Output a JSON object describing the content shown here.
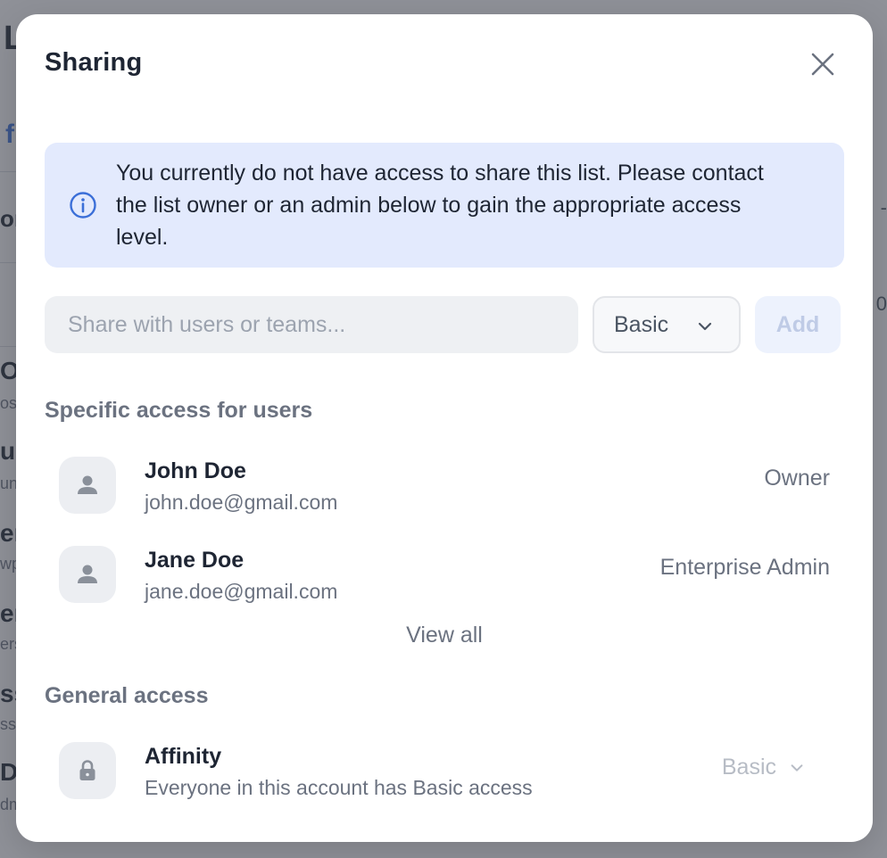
{
  "background": {
    "fragments": [
      "L",
      "f",
      "on",
      "O",
      "os",
      "ur",
      "un",
      "er",
      "wp",
      "er",
      "ers",
      "ss",
      "ss",
      "D",
      "dm"
    ],
    "right_fragments": [
      "-",
      "0"
    ]
  },
  "modal": {
    "title": "Sharing",
    "close_icon": "close-icon"
  },
  "notice": {
    "icon": "info-icon",
    "text": "You currently do not have access to share this list. Please contact the list owner or an admin below to gain the appropriate access level."
  },
  "share": {
    "placeholder": "Share with users or teams...",
    "value": "",
    "access_level": "Basic",
    "add_label": "Add"
  },
  "specific_access": {
    "heading": "Specific access for users",
    "users": [
      {
        "name": "John Doe",
        "email": "john.doe@gmail.com",
        "role": "Owner"
      },
      {
        "name": "Jane Doe",
        "email": "jane.doe@gmail.com",
        "role": "Enterprise Admin"
      }
    ],
    "view_all_label": "View all"
  },
  "general_access": {
    "heading": "General access",
    "name": "Affinity",
    "description": "Everyone in this account has Basic access",
    "level": "Basic"
  },
  "colors": {
    "accent_blue": "#3b6fd8",
    "banner_bg": "#e3eafd",
    "text_primary": "#1e2533",
    "text_secondary": "#6b7280"
  }
}
